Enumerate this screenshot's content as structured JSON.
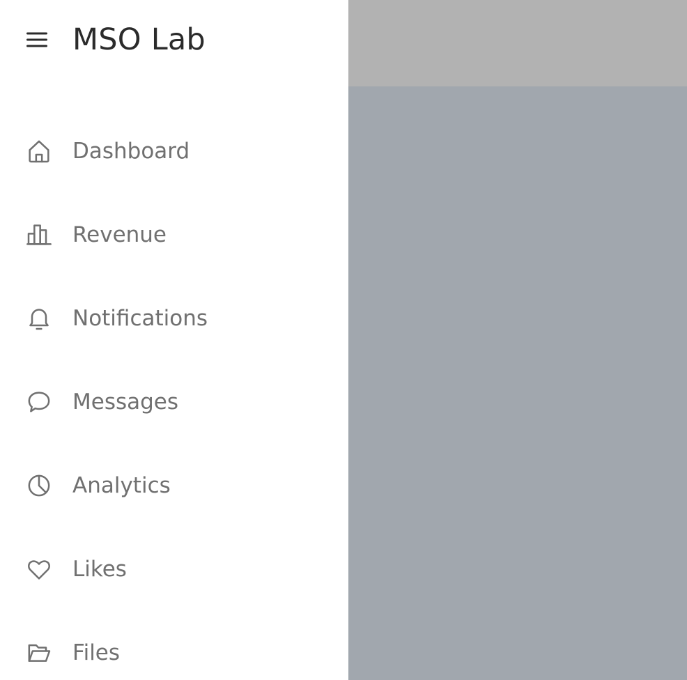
{
  "app": {
    "title": "MSO Lab"
  },
  "colors": {
    "drawer_bg": "#ffffff",
    "overlay_bg": "#a1a7ae",
    "overlay_header_bg": "#b2b2b2",
    "title_text": "#2b2b2b",
    "nav_text": "#707070"
  },
  "sidebar": {
    "menu_icon": "hamburger-menu-icon",
    "items": [
      {
        "label": "Dashboard",
        "icon": "home-icon"
      },
      {
        "label": "Revenue",
        "icon": "bar-chart-icon"
      },
      {
        "label": "Notifications",
        "icon": "bell-icon"
      },
      {
        "label": "Messages",
        "icon": "chat-bubble-icon"
      },
      {
        "label": "Analytics",
        "icon": "pie-chart-icon"
      },
      {
        "label": "Likes",
        "icon": "heart-icon"
      },
      {
        "label": "Files",
        "icon": "folder-open-icon"
      }
    ]
  }
}
